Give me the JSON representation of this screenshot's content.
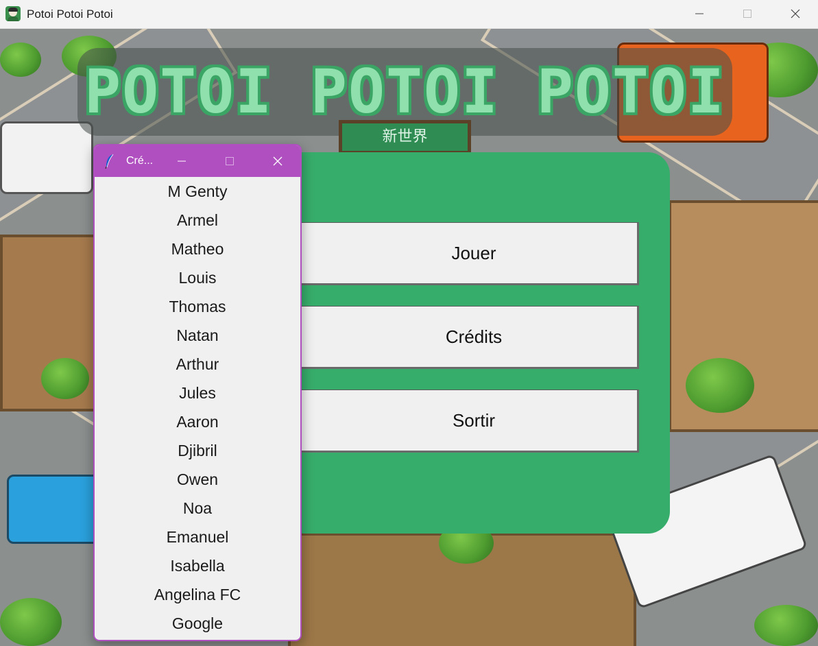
{
  "window": {
    "title": "Potoi Potoi Potoi",
    "icon": "app-avatar-icon",
    "controls": [
      "minimize-icon",
      "maximize-icon",
      "close-icon"
    ]
  },
  "game": {
    "banner_title": "POTOI POTOI POTOI",
    "sign_text": "新世界"
  },
  "menu": {
    "buttons": [
      {
        "label": "Jouer"
      },
      {
        "label": "Crédits"
      },
      {
        "label": "Sortir"
      }
    ]
  },
  "credits_window": {
    "title": "Cré...",
    "icon": "feather-icon",
    "names": [
      "M Genty",
      "Armel",
      "Matheo",
      "Louis",
      "Thomas",
      "Natan",
      "Arthur",
      "Jules",
      "Aaron",
      "Djibril",
      "Owen",
      "Noa",
      "Emanuel",
      "Isabella",
      "Angelina FC",
      "Google"
    ]
  },
  "colors": {
    "panel_green": "#37ad6b",
    "credits_accent": "#b04fc0",
    "banner_text": "#8fe0ad"
  }
}
